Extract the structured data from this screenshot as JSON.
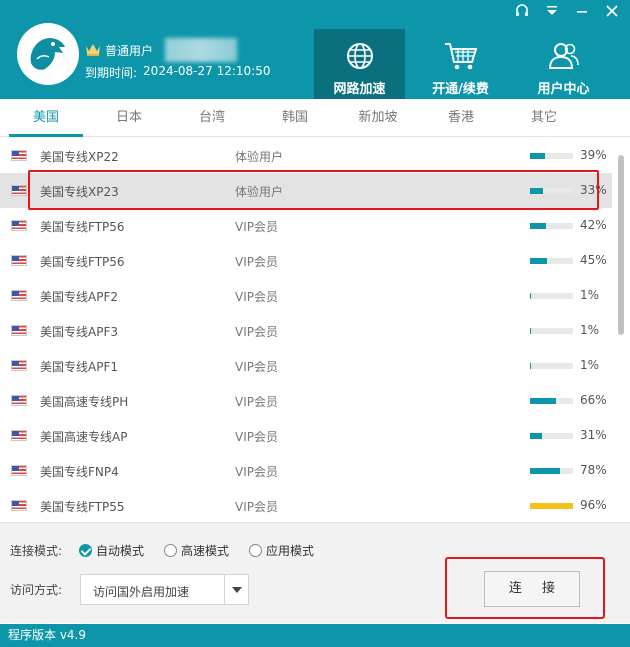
{
  "header": {
    "user_type": "普通用户",
    "expire_label": "到期时间:",
    "expire_value": "2024-08-27 12:10:50",
    "nav": [
      {
        "label": "网路加速",
        "icon": "globe-icon",
        "active": true
      },
      {
        "label": "开通/续费",
        "icon": "cart-icon",
        "active": false
      },
      {
        "label": "用户中心",
        "icon": "users-icon",
        "active": false
      }
    ],
    "accent_color": "#0d96aa"
  },
  "tabs": [
    {
      "label": "美国",
      "active": true
    },
    {
      "label": "日本"
    },
    {
      "label": "台湾"
    },
    {
      "label": "韩国"
    },
    {
      "label": "新加坡"
    },
    {
      "label": "香港"
    },
    {
      "label": "其它"
    }
  ],
  "servers": [
    {
      "name": "美国专线XP22",
      "type": "体验用户",
      "load": 39,
      "load_label": "39%"
    },
    {
      "name": "美国专线XP23",
      "type": "体验用户",
      "load": 33,
      "load_label": "33%",
      "selected": true
    },
    {
      "name": "美国专线FTP56",
      "type": "VIP会员",
      "load": 42,
      "load_label": "42%"
    },
    {
      "name": "美国专线FTP56",
      "type": "VIP会员",
      "load": 45,
      "load_label": "45%"
    },
    {
      "name": "美国专线APF2",
      "type": "VIP会员",
      "load": 1,
      "load_label": "1%"
    },
    {
      "name": "美国专线APF3",
      "type": "VIP会员",
      "load": 1,
      "load_label": "1%"
    },
    {
      "name": "美国专线APF1",
      "type": "VIP会员",
      "load": 1,
      "load_label": "1%"
    },
    {
      "name": "美国高速专线PH",
      "type": "VIP会员",
      "load": 66,
      "load_label": "66%"
    },
    {
      "name": "美国高速专线AP",
      "type": "VIP会员",
      "load": 31,
      "load_label": "31%"
    },
    {
      "name": "美国专线FNP4",
      "type": "VIP会员",
      "load": 78,
      "load_label": "78%"
    },
    {
      "name": "美国专线FTP55",
      "type": "VIP会员",
      "load": 96,
      "load_label": "96%"
    }
  ],
  "bar_colors": {
    "normal": "#0d96aa",
    "high": "#f5c11b"
  },
  "bottom": {
    "mode_label": "连接模式:",
    "modes": [
      {
        "label": "自动模式",
        "checked": true
      },
      {
        "label": "高速模式",
        "checked": false
      },
      {
        "label": "应用模式",
        "checked": false
      }
    ],
    "access_label": "访问方式:",
    "access_value": "访问国外启用加速",
    "connect_label": "连 接"
  },
  "status": {
    "version": "程序版本 v4.9"
  }
}
